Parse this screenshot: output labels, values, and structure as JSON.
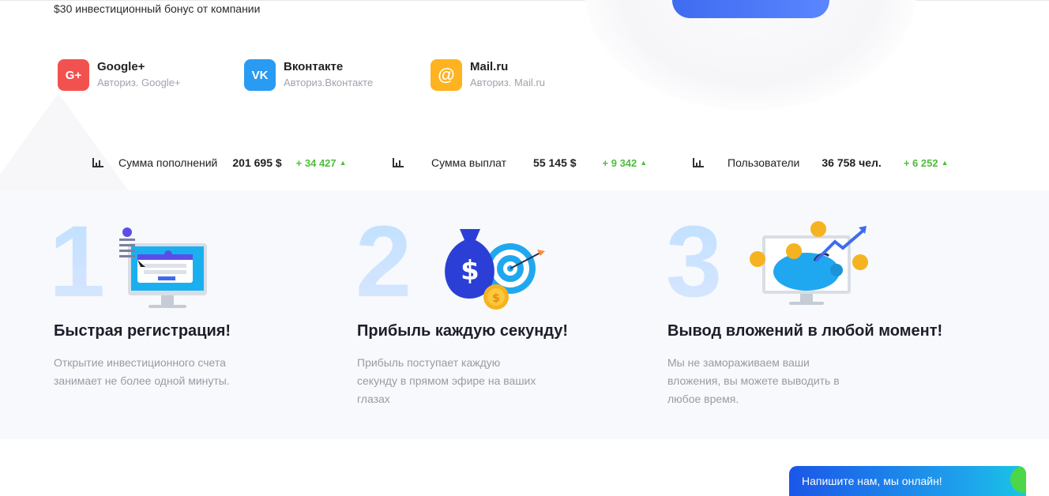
{
  "header": {
    "bonus_text": "$30 инвестиционный бонус от компании"
  },
  "social": [
    {
      "icon": "google-plus-icon",
      "glyph": "G+",
      "color": "#f2524f",
      "name": "Google+",
      "sub": "Авториз. Google+"
    },
    {
      "icon": "vk-icon",
      "glyph": "VK",
      "color": "#2a9bf2",
      "name": "Вконтакте",
      "sub": "Авториз.Вконтакте"
    },
    {
      "icon": "mailru-icon",
      "glyph": "@",
      "color": "#ffb320",
      "name": "Mail.ru",
      "sub": "Авториз. Mail.ru"
    }
  ],
  "stats": [
    {
      "icon": "bar-chart-icon",
      "label": "Сумма пополнений",
      "value": "201 695 $",
      "delta": "+ 34 427"
    },
    {
      "icon": "bar-chart-icon",
      "label": "Сумма выплат",
      "value": "55 145 $",
      "delta": "+ 9 342"
    },
    {
      "icon": "bar-chart-icon",
      "label": "Пользователи",
      "value": "36 758 чел.",
      "delta": "+ 6 252"
    }
  ],
  "features": [
    {
      "number": "1",
      "icon": "registration-computer-icon",
      "title": "Быстрая регистрация!",
      "desc": "Открытие инвестиционного счета занимает не более одной минуты."
    },
    {
      "number": "2",
      "icon": "money-bag-target-icon",
      "title": "Прибыль каждую секунду!",
      "desc": "Прибыль поступает каждую секунду в прямом эфире на ваших глазах"
    },
    {
      "number": "3",
      "icon": "piggy-bank-monitor-icon",
      "title": "Вывод вложений в любой момент!",
      "desc": "Мы не замораживаем ваши вложения, вы можете выводить в любое время."
    }
  ],
  "chat": {
    "label": "Напишите нам, мы онлайн!"
  },
  "colors": {
    "accent": "#3f6bf0",
    "positive": "#4fbe3c",
    "band_bg": "#f8f9fc"
  }
}
